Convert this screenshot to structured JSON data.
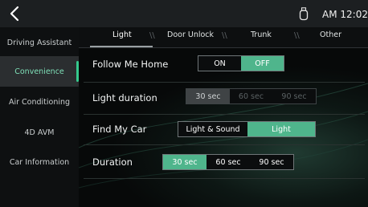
{
  "status_bar": {
    "clock": "AM 12:02",
    "back_icon": "chevron-left-icon",
    "usb_icon": "usb-icon"
  },
  "sidebar": {
    "items": [
      {
        "label": "Driving Assistant",
        "active": false
      },
      {
        "label": "Convenience",
        "active": true
      },
      {
        "label": "Air Conditioning",
        "active": false
      },
      {
        "label": "4D AVM",
        "active": false
      },
      {
        "label": "Car Information",
        "active": false
      }
    ]
  },
  "tabs": [
    {
      "label": "Light",
      "active": true
    },
    {
      "label": "Door Unlock",
      "active": false
    },
    {
      "label": "Trunk",
      "active": false
    },
    {
      "label": "Other",
      "active": false
    }
  ],
  "settings": {
    "follow_me_home": {
      "label": "Follow Me Home",
      "options": [
        "ON",
        "OFF"
      ],
      "selected": "OFF"
    },
    "light_duration": {
      "label": "Light duration",
      "options": [
        "30 sec",
        "60 sec",
        "90 sec"
      ],
      "selected": "30 sec",
      "enabled": false
    },
    "find_my_car": {
      "label": "Find My Car",
      "options": [
        "Light & Sound",
        "Light"
      ],
      "selected": "Light"
    },
    "duration": {
      "label": "Duration",
      "options": [
        "30 sec",
        "60 sec",
        "90 sec"
      ],
      "selected": "30 sec"
    }
  },
  "colors": {
    "accent": "#4fb58c",
    "sidebar_active_text": "#7fe0b8",
    "background": "#060708"
  }
}
